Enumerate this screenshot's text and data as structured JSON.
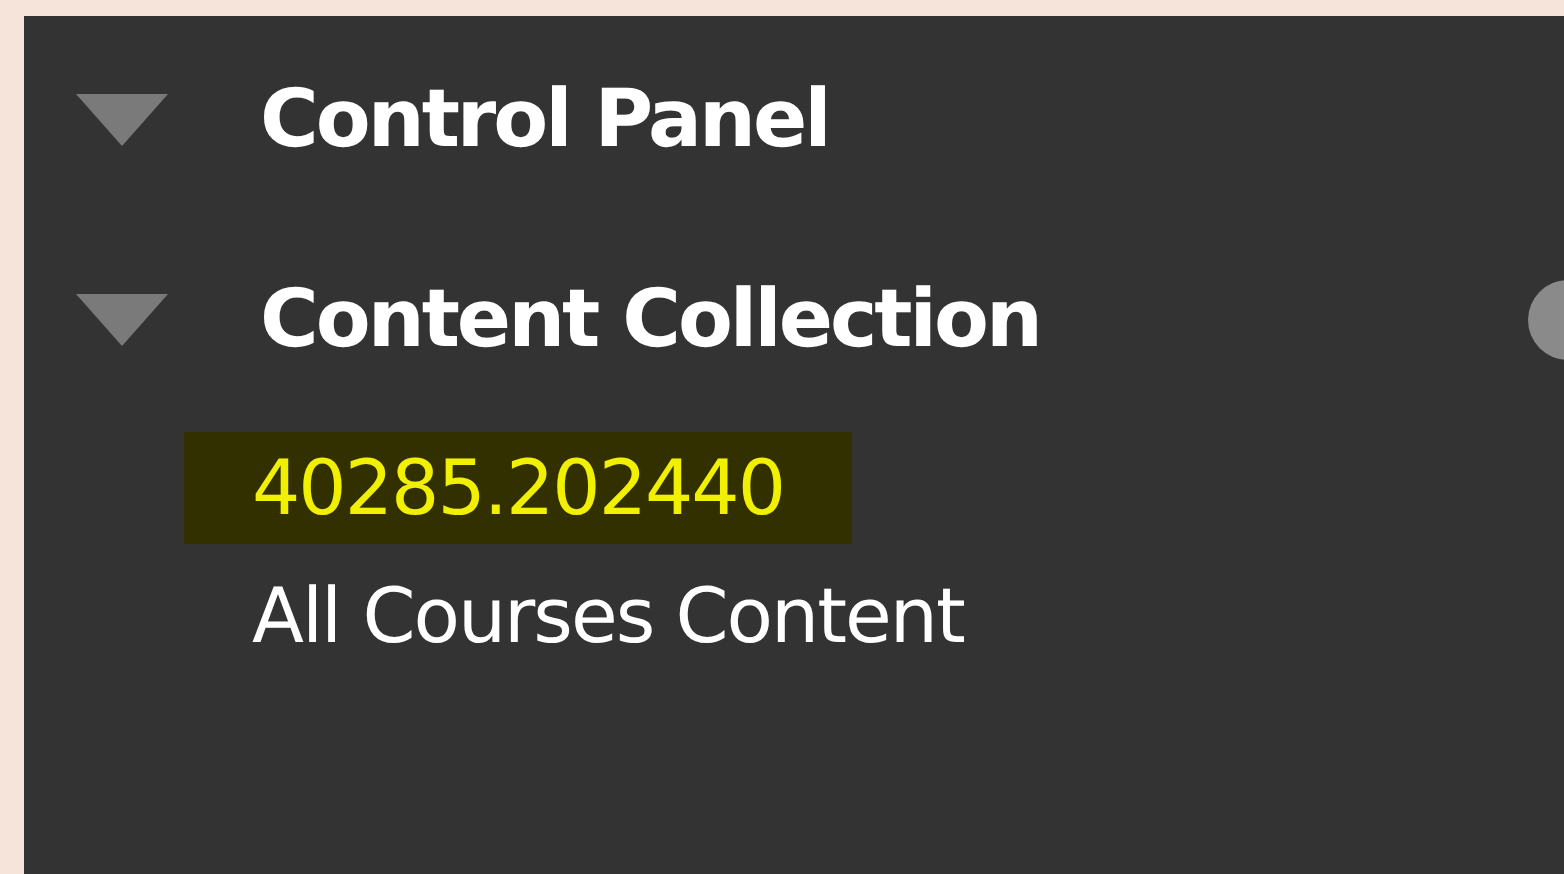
{
  "sections": [
    {
      "title": "Control Panel",
      "expanded": true
    },
    {
      "title": "Content Collection",
      "expanded": true,
      "items": [
        {
          "label": "40285.202440",
          "selected": true
        },
        {
          "label": "All Courses Content",
          "selected": false
        }
      ]
    }
  ]
}
